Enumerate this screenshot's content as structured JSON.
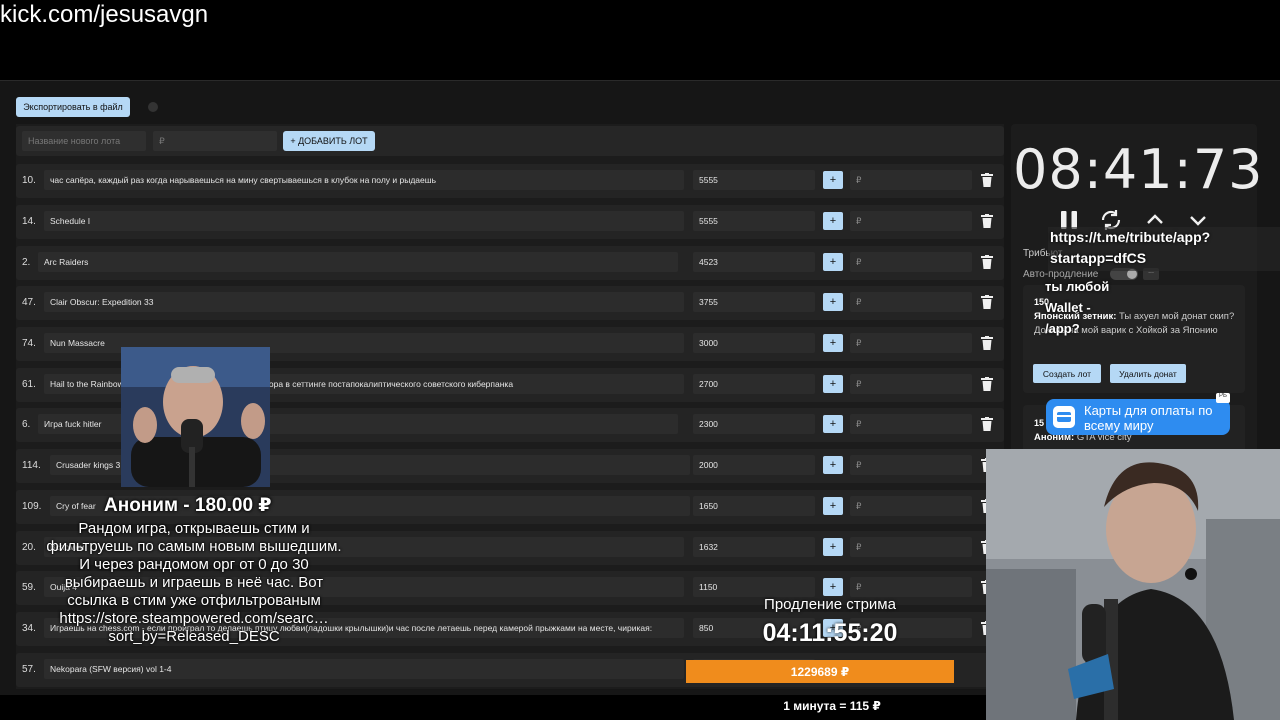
{
  "channel_url": "kick.com/jesusavgn",
  "toolbar": {
    "export_label": "Экспортировать в файл"
  },
  "new_lot": {
    "name_placeholder": "Название нового лота",
    "price_placeholder": "₽",
    "add_label": "+ ДОБАВИТЬ ЛОТ"
  },
  "lots": [
    {
      "num": "10.",
      "title": "час сапёра, каждый раз когда нарываешься на мину свертываешься в клубок на полу и рыдаешь",
      "amount": "5555",
      "plus": "+",
      "add_placeholder": "₽"
    },
    {
      "num": "14.",
      "title": "Schedule I",
      "amount": "5555",
      "plus": "+",
      "add_placeholder": "₽"
    },
    {
      "num": "2.",
      "title": "Arc Raiders",
      "amount": "4523",
      "plus": "+",
      "add_placeholder": "₽"
    },
    {
      "num": "47.",
      "title": "Clair Obscur: Expedition 33",
      "amount": "3755",
      "plus": "+",
      "add_placeholder": "₽"
    },
    {
      "num": "74.",
      "title": "Nun Massacre",
      "amount": "3000",
      "plus": "+",
      "add_placeholder": "₽"
    },
    {
      "num": "61.",
      "title": "Hail to the Rainbow                                   о лица с элементами шутера и хоррора в сеттинге постапокалиптического советского киберпанка",
      "amount": "2700",
      "plus": "+",
      "add_placeholder": "₽"
    },
    {
      "num": "6.",
      "title": "Игра fuck hitler",
      "amount": "2300",
      "plus": "+",
      "add_placeholder": "₽"
    },
    {
      "num": "114.",
      "title": "Crusader kings 3",
      "amount": "2000",
      "plus": "+",
      "add_placeholder": "₽"
    },
    {
      "num": "109.",
      "title": "Cry of fear",
      "amount": "1650",
      "plus": "+",
      "add_placeholder": "₽"
    },
    {
      "num": "20.",
      "title": "Вспомни",
      "amount": "1632",
      "plus": "+",
      "add_placeholder": "₽"
    },
    {
      "num": "59.",
      "title": "Ouija 4",
      "amount": "1150",
      "plus": "+",
      "add_placeholder": "₽"
    },
    {
      "num": "34.",
      "title": "Играешь на chess.com - если проиграл то делаешь птицу любви(ладошки крылышки)и час после летаешь перед камерой прыжками на месте, чирикая:",
      "amount": "850",
      "plus": "+",
      "add_placeholder": "₽"
    },
    {
      "num": "57.",
      "title": "Nekopara (SFW версия) vol 1-4",
      "amount": "",
      "plus": "",
      "add_placeholder": ""
    }
  ],
  "timer": {
    "value": "08:41:73"
  },
  "settings": {
    "tribute_label": "Трибьют",
    "auto_extend_label": "Авто-продление",
    "auto_extra": "..."
  },
  "overlay": {
    "tribute_link": "https://t.me/tribute/app?startapp=dfCS",
    "wallet_text_1": "ты любой",
    "wallet_text_2": "Wallet -",
    "wallet_text_3": "/app?"
  },
  "donation": {
    "amount": "150",
    "author": "Японский зетник:",
    "message": "Ты ахуел мой донат скип? Докинь на мой варик с Хойкой за Японию",
    "create_lot_label": "Создать лот",
    "delete_label": "Удалить донат"
  },
  "donation2": {
    "amount": "15",
    "author": "Аноним:",
    "message": "GTA vice city"
  },
  "wallet_ad": {
    "text": "Карты для оплаты по всему миру",
    "badge": "РБ"
  },
  "alert": {
    "name": "Аноним - 180.00 ₽",
    "message": "Рандом игра, открываешь стим и фильтруешь по самым новым вышедшим. И через рандомом орг от 0 до 30 выбираешь и играешь в неё час. Вот ссылка в стим уже отфильтрованым https://store.steampowered.com/searc… sort_by=Released_DESC"
  },
  "stream": {
    "extension_label": "Продление стрима",
    "extension_time": "04:11:55:20",
    "total": "1229689 ₽",
    "rate": "1 минута = 115 ₽"
  },
  "colors": {
    "accent": "#b5d8f5",
    "orange": "#f08c1c",
    "wallet_blue": "#2e8cf0",
    "panel": "#1c1c1c",
    "row": "#242424"
  }
}
